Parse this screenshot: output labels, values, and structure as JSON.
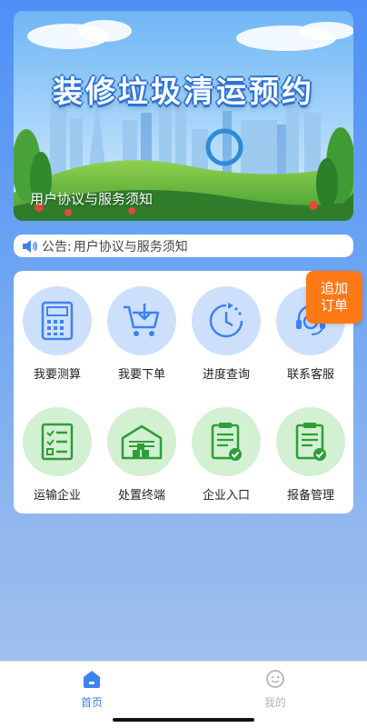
{
  "banner": {
    "title": "装修垃圾清运预约",
    "caption": "用户协议与服务须知"
  },
  "notice": {
    "prefix": "公告:",
    "text": "用户协议与服务须知",
    "icon": "speaker-icon"
  },
  "grid": {
    "items": [
      {
        "label": "我要测算",
        "icon": "calculator-icon"
      },
      {
        "label": "我要下单",
        "icon": "cart-download-icon"
      },
      {
        "label": "进度查询",
        "icon": "clock-progress-icon"
      },
      {
        "label": "联系客服",
        "icon": "customer-service-icon"
      },
      {
        "label": "运输企业",
        "icon": "checklist-icon"
      },
      {
        "label": "处置终端",
        "icon": "warehouse-icon"
      },
      {
        "label": "企业入口",
        "icon": "clipboard-check-icon"
      },
      {
        "label": "报备管理",
        "icon": "clipboard-check-icon"
      }
    ]
  },
  "floating_badge": {
    "line1": "追加",
    "line2": "订单"
  },
  "tabbar": {
    "tabs": [
      {
        "label": "首页",
        "icon": "home-icon",
        "active": true
      },
      {
        "label": "我的",
        "icon": "smiley-icon",
        "active": false
      }
    ]
  },
  "colors": {
    "accent": "#3d82f0",
    "badge": "#ff7a17",
    "tile_blue": "#cde0fb",
    "tile_green": "#d3f0d2",
    "icon_green": "#2e9e3a"
  }
}
